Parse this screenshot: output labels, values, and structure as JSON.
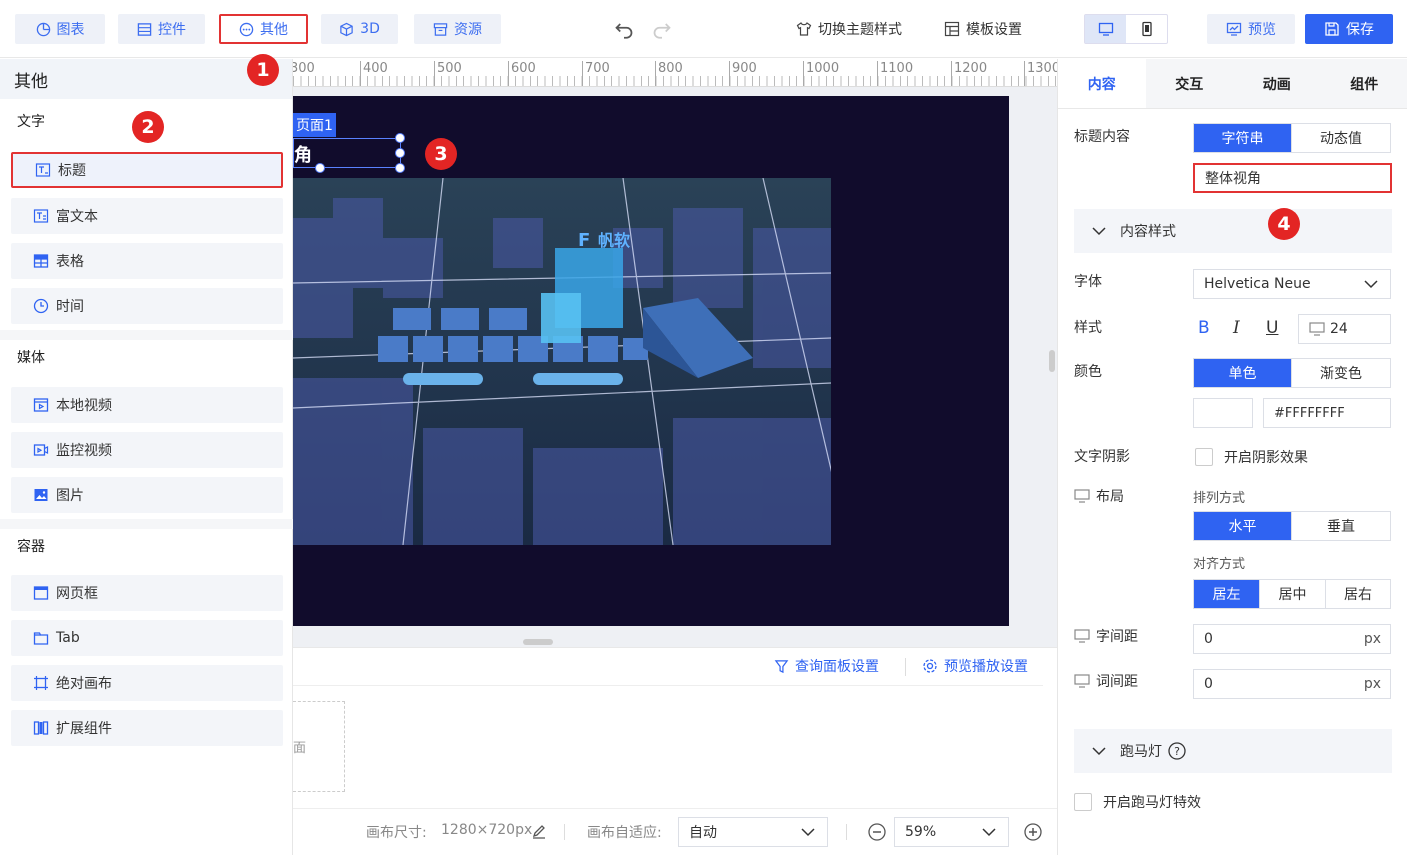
{
  "toolbar": {
    "tabs": [
      {
        "label": "图表",
        "icon": "chart-pie-icon"
      },
      {
        "label": "控件",
        "icon": "widget-icon"
      },
      {
        "label": "其他",
        "icon": "more-icon"
      },
      {
        "label": "3D",
        "icon": "cube-icon"
      },
      {
        "label": "资源",
        "icon": "archive-icon"
      }
    ],
    "theme_label": "切换主题样式",
    "template_label": "模板设置",
    "preview_label": "预览",
    "save_label": "保存"
  },
  "badges": [
    "1",
    "2",
    "3",
    "4"
  ],
  "left_panel": {
    "title": "其他",
    "sections": [
      {
        "title": "文字",
        "items": [
          "标题",
          "富文本",
          "表格",
          "时间"
        ]
      },
      {
        "title": "媒体",
        "items": [
          "本地视频",
          "监控视频",
          "图片"
        ]
      },
      {
        "title": "容器",
        "items": [
          "网页框",
          "Tab",
          "绝对画布",
          "扩展组件"
        ]
      }
    ]
  },
  "ruler": {
    "ticks": [
      "300",
      "400",
      "500",
      "600",
      "700",
      "800",
      "900",
      "1000",
      "1100",
      "1200",
      "1300"
    ]
  },
  "canvas": {
    "page_tag": "页面1",
    "title_text": "角",
    "logo_text": "帆软",
    "query_panel_label": "查询面板设置",
    "preview_play_label": "预览播放设置",
    "placeholder_text": "面",
    "size_label": "画布尺寸:",
    "size_value": "1280×720px",
    "adapt_label": "画布自适应:",
    "adapt_value": "自动",
    "zoom_value": "59%"
  },
  "right_panel": {
    "tabs": [
      "内容",
      "交互",
      "动画",
      "组件"
    ],
    "title_content_label": "标题内容",
    "type_options": [
      "字符串",
      "动态值"
    ],
    "title_value": "整体视角",
    "content_style_label": "内容样式",
    "font_label": "字体",
    "font_value": "Helvetica Neue",
    "style_label": "样式",
    "bold": "B",
    "italic": "I",
    "underline": "U",
    "font_size": "24",
    "color_label": "颜色",
    "color_options": [
      "单色",
      "渐变色"
    ],
    "color_value": "#FFFFFFFF",
    "shadow_label": "文字阴影",
    "shadow_option": "开启阴影效果",
    "layout_label": "布局",
    "arrange_label": "排列方式",
    "arrange_options": [
      "水平",
      "垂直"
    ],
    "align_label": "对齐方式",
    "align_options": [
      "居左",
      "居中",
      "居右"
    ],
    "letter_spacing_label": "字间距",
    "letter_spacing_value": "0",
    "word_spacing_label": "词间距",
    "word_spacing_value": "0",
    "unit": "px",
    "marquee_label": "跑马灯",
    "marquee_option": "开启跑马灯特效"
  },
  "colors": {
    "accent": "#2f63f2",
    "highlight": "#e23333",
    "stage": "#110c2c"
  }
}
